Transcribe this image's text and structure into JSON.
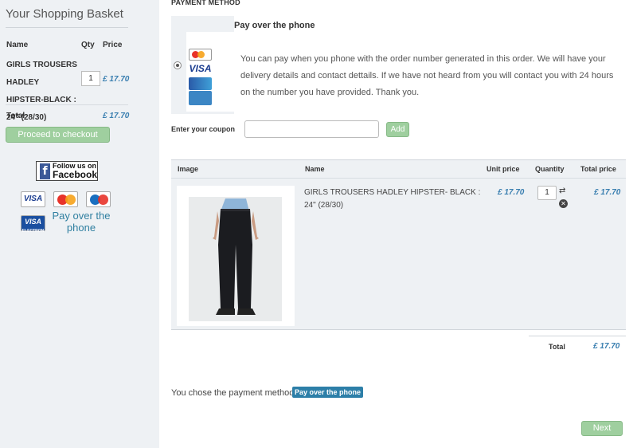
{
  "sidebar": {
    "title": "Your Shopping Basket",
    "headers": {
      "name": "Name",
      "qty": "Qty",
      "price": "Price"
    },
    "item": {
      "name": "GIRLS TROUSERS HADLEY HIPSTER-BLACK : 24\" (28/30)",
      "qty": "1",
      "price": "£ 17.70"
    },
    "total_label": "Total",
    "total_value": "£ 17.70",
    "checkout_label": "Proceed to checkout",
    "facebook": {
      "small": "Follow us on",
      "big": "Facebook"
    },
    "cards": {
      "visa": "VISA",
      "visa_electron": "VISA",
      "visa_electron_sub": "ELECTRON"
    },
    "pay_phone_text": "Pay over the phone"
  },
  "payment": {
    "heading": "PAYMENT METHOD",
    "title": "Pay over the phone",
    "description": "You can pay when you phone with the order number generated in this order. We will have your delivery details and contact dettails. If we have not heard from you will contact you with 24 hours on the number you have provided. Thank you.",
    "mini_cards": {
      "visa": "VISA"
    }
  },
  "coupon": {
    "label": "Enter your coupon",
    "value": "",
    "button": "Add"
  },
  "cart": {
    "headers": {
      "image": "Image",
      "name": "Name",
      "unit_price": "Unit price",
      "quantity": "Quantity",
      "total_price": "Total price"
    },
    "rows": [
      {
        "name": "GIRLS TROUSERS HADLEY HIPSTER- BLACK : 24\" (28/30)",
        "unit_price": "£ 17.70",
        "quantity": "1",
        "total_price": "£ 17.70"
      }
    ],
    "total_label": "Total",
    "total_value": "£ 17.70"
  },
  "chosen": {
    "text": "You chose the payment method:",
    "method": "Pay over the phone"
  },
  "next_label": "Next",
  "colors": {
    "accent": "#2d7fa8",
    "button_green": "#9fcf9f",
    "price_blue": "#3a7fb0",
    "panel_bg": "#eef1f4"
  },
  "icons": [
    "facebook-icon",
    "visa-card-icon",
    "mastercard-icon",
    "maestro-icon",
    "visa-electron-icon",
    "american-express-icon",
    "refresh-icon",
    "remove-icon"
  ]
}
